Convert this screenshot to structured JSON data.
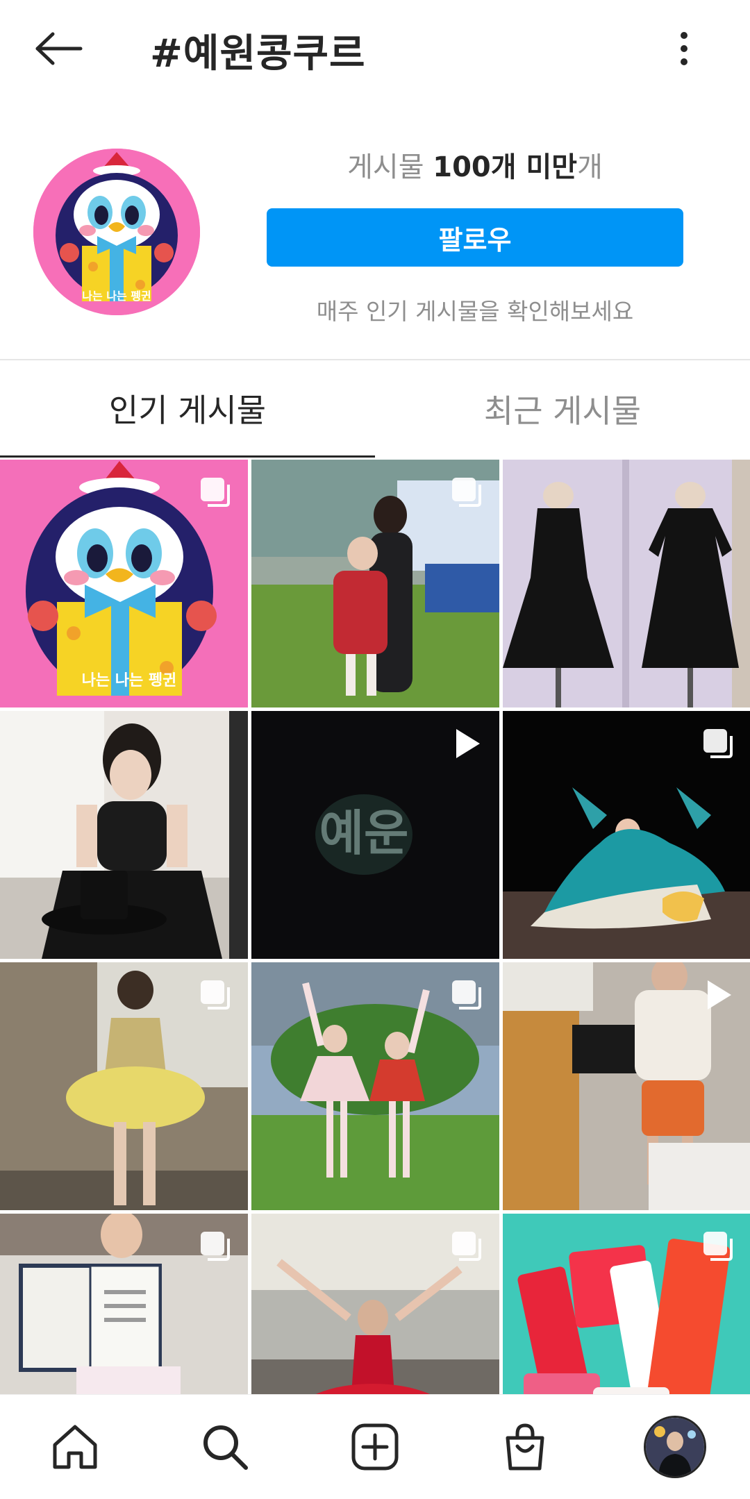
{
  "header": {
    "back_icon": "arrow-left-icon",
    "title": "#예원콩쿠르",
    "more_icon": "more-vertical-icon"
  },
  "profile": {
    "stats_prefix": "게시물 ",
    "stats_bold": "100개 미만",
    "stats_suffix": "개",
    "follow_label": "팔로우",
    "hint": "매주 인기 게시물을 확인해보세요"
  },
  "tabs": {
    "top": "인기 게시물",
    "recent": "최근 게시물"
  },
  "posts": [
    {
      "type": "carousel",
      "badge_icon": "multiple-images-icon",
      "thumb_text": "나는 나는 펭귄"
    },
    {
      "type": "carousel",
      "badge_icon": "multiple-images-icon"
    },
    {
      "type": "image"
    },
    {
      "type": "image"
    },
    {
      "type": "video",
      "badge_icon": "play-icon",
      "thumb_text": "예운"
    },
    {
      "type": "carousel",
      "badge_icon": "multiple-images-icon"
    },
    {
      "type": "carousel",
      "badge_icon": "multiple-images-icon"
    },
    {
      "type": "carousel",
      "badge_icon": "multiple-images-icon"
    },
    {
      "type": "video",
      "badge_icon": "play-icon"
    },
    {
      "type": "carousel",
      "badge_icon": "multiple-images-icon"
    },
    {
      "type": "carousel",
      "badge_icon": "multiple-images-icon"
    },
    {
      "type": "carousel",
      "badge_icon": "multiple-images-icon"
    }
  ],
  "bottom_nav": [
    {
      "name": "home",
      "icon": "home-icon"
    },
    {
      "name": "search",
      "icon": "search-icon"
    },
    {
      "name": "create",
      "icon": "add-post-icon"
    },
    {
      "name": "shop",
      "icon": "shopping-bag-icon"
    },
    {
      "name": "profile",
      "icon": "profile-avatar-icon"
    }
  ],
  "colors": {
    "accent": "#0095f6",
    "text": "#262626",
    "muted": "#8e8e8e"
  }
}
